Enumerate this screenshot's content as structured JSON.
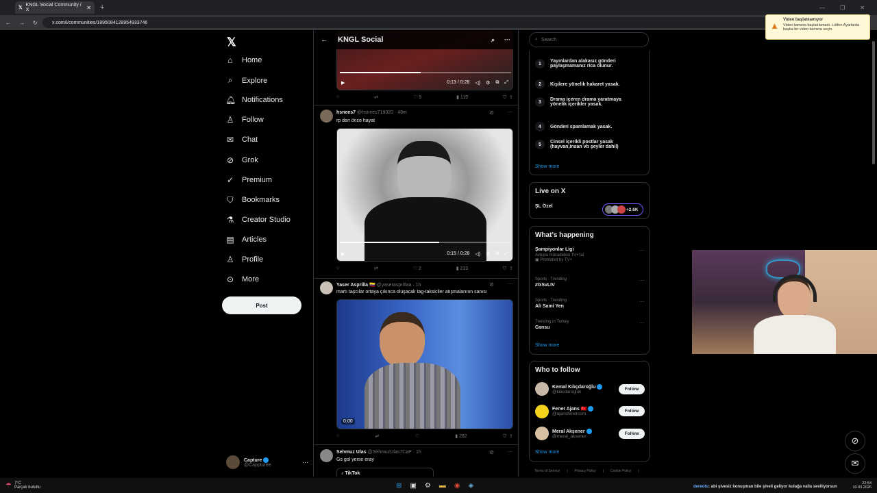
{
  "browser": {
    "tab_title": "KNGL Social Community / X",
    "url": "x.com/i/communities/1895084128954933746"
  },
  "sidebar": {
    "items": [
      {
        "label": "Home",
        "icon": "home-icon"
      },
      {
        "label": "Explore",
        "icon": "search-icon"
      },
      {
        "label": "Notifications",
        "icon": "bell-icon"
      },
      {
        "label": "Follow",
        "icon": "person-plus-icon"
      },
      {
        "label": "Chat",
        "icon": "envelope-icon"
      },
      {
        "label": "Grok",
        "icon": "grok-icon"
      },
      {
        "label": "Premium",
        "icon": "x-premium-icon"
      },
      {
        "label": "Bookmarks",
        "icon": "bookmark-icon"
      },
      {
        "label": "Creator Studio",
        "icon": "flask-icon"
      },
      {
        "label": "Articles",
        "icon": "article-icon"
      },
      {
        "label": "Profile",
        "icon": "person-icon"
      },
      {
        "label": "More",
        "icon": "more-circle-icon"
      }
    ],
    "post_label": "Post",
    "account": {
      "name": "Capture",
      "handle": "@Cappturee"
    }
  },
  "feed": {
    "title": "KNGL Social",
    "post0": {
      "time": "0:13 / 0:28",
      "likes": "5",
      "views": "119",
      "progress": 0.47
    },
    "post1": {
      "name": "hsnees7",
      "handle": "@hsnees719320",
      "time": "· 48m",
      "text": "rp den önce hayat",
      "video_time": "0:15 / 0:28",
      "progress": 0.58,
      "likes": "2",
      "views": "219"
    },
    "post2": {
      "name": "Yaser Asprilla 🇨🇴",
      "handle": "@yaseraspriIlaa",
      "time": "· 1h",
      "text": "martı taşcılar ortaya çıkınca oluşacak tag-taksiciler atışmalarının sanısı",
      "video_time": "0:00",
      "views": "262"
    },
    "post3": {
      "name": "Sehmuz Ulas",
      "handle": "@SehmuzUlas7CaP",
      "time": "· 1h",
      "text": "Gs gol yerse eray",
      "embed": "TikTok"
    }
  },
  "right": {
    "search_placeholder": "Search",
    "rules": [
      {
        "n": "1",
        "text": "Yayınlardan alakasız gönderi paylaşmamanız rica olunur."
      },
      {
        "n": "2",
        "text": "Kişilere yönelik hakaret yasak."
      },
      {
        "n": "3",
        "text": "Drama içeren drama yaratmaya yönelik içerikler yasak."
      },
      {
        "n": "4",
        "text": "Gönderi spamlamak yasak."
      },
      {
        "n": "5",
        "text": "Cinsel içerikli postlar yasak (hayvan,insan vb şeyler dahil)"
      }
    ],
    "show_more": "Show more",
    "live": {
      "title": "Live on X",
      "name": "ŞL Özel",
      "count": "+2.6K"
    },
    "happening": {
      "title": "What's happening",
      "trends": [
        {
          "meta": "Avrupa mücadelesi TV+'tal",
          "name": "Şampiyonlar Ligi",
          "sub": "Promoted by TV+"
        },
        {
          "meta": "Sports · Trending",
          "name": "#GSvLIV"
        },
        {
          "meta": "Sports · Trending",
          "name": "Ali Sami Yen"
        },
        {
          "meta": "Trending in Turkey",
          "name": "Cansu"
        }
      ]
    },
    "who": {
      "title": "Who to follow",
      "follow_label": "Follow",
      "people": [
        {
          "name": "Kemal Kılıçdaroğlu",
          "handle": "@kilicdarogluk"
        },
        {
          "name": "Fener Ajans 🇹🇷",
          "handle": "@ajansfenercom"
        },
        {
          "name": "Meral Akşener",
          "handle": "@meral_aksener"
        }
      ]
    },
    "footer": [
      "Terms of Service",
      "Privacy Policy",
      "Cookie Policy"
    ]
  },
  "notice": {
    "title": "Video başlatılamıyor",
    "body": "Video kamera başlatılamadı. Lütfen Ayarlarda başka bir video kamera seçin."
  },
  "taskbar": {
    "weather_temp": "7°C",
    "weather_text": "Parçalı bulutlu",
    "chat_user": "dereotu",
    "chat_text": ": abi şivesiz konuşman bile şiveli geliyor kulağa valla seviliyorsun",
    "time": "22:54",
    "date": "10.03.2026"
  }
}
